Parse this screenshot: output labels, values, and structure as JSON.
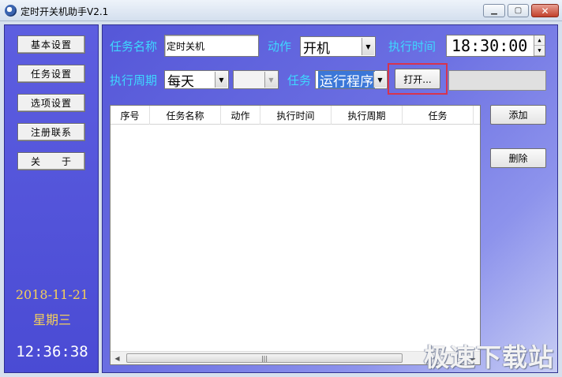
{
  "window": {
    "title": "定时开关机助手V2.1"
  },
  "sidebar": {
    "buttons": [
      {
        "label": "基本设置"
      },
      {
        "label": "任务设置"
      },
      {
        "label": "选项设置"
      },
      {
        "label": "注册联系"
      },
      {
        "label": "关　　于"
      }
    ],
    "date": "2018-11-21",
    "weekday": "星期三",
    "clock": "12:36:38"
  },
  "form": {
    "task_name_label": "任务名称",
    "task_name_value": "定时关机",
    "action_label": "动作",
    "action_value": "开机",
    "exec_time_label": "执行时间",
    "exec_time_value": "18:30:00",
    "period_label": "执行周期",
    "period_value": "每天",
    "period_sub_value": "",
    "task_label": "任务",
    "task_value": "运行程序",
    "open_button": "打开...",
    "path_value": ""
  },
  "list": {
    "columns": [
      "序号",
      "任务名称",
      "动作",
      "执行时间",
      "执行周期",
      "任务"
    ],
    "rows": []
  },
  "actions": {
    "add": "添加",
    "delete": "删除"
  },
  "watermark": "极速下载站",
  "colors": {
    "label": "#3ed8ff",
    "date": "#f3cf5b",
    "highlight": "#d7344e",
    "panel": "#5557d8"
  }
}
